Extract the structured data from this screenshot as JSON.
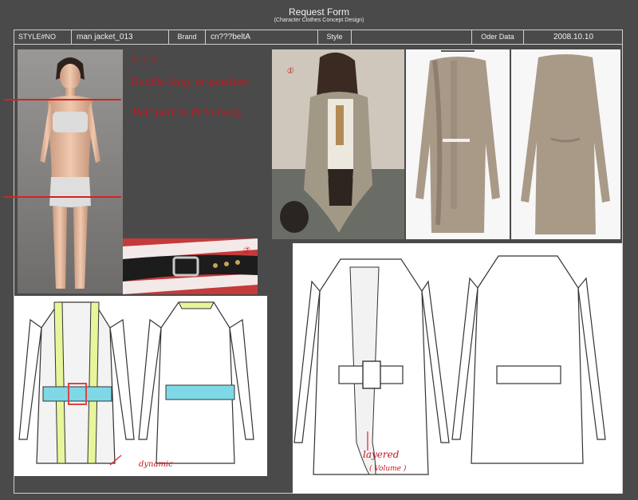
{
  "form": {
    "title": "Request Form",
    "subtitle": "(Character Clothes Concept Design)"
  },
  "header": {
    "style_no_label": "STYLE#NO",
    "style_no_value": "man jacket_013",
    "brand_label": "Brand",
    "brand_value": "cn???beltA",
    "style_label": "Style",
    "style_value": "",
    "order_date_label": "Oder Data",
    "order_date_value": "2008.10.10"
  },
  "annotations": {
    "marker_1": "① + ②",
    "note_line_1": "Double long, or position.",
    "note_line_2": "Belt part to fit to body.",
    "marker_belt": "②",
    "marker_photo": "①",
    "dynamic": "dynamic",
    "layered": "layered",
    "volume": "( Volume )"
  },
  "colors": {
    "background": "#4a4a4a",
    "accent_red": "#d32222",
    "trim_yellow": "#e8f59a",
    "belt_cyan": "#7fd8e6",
    "cardigan_taupe": "#a99a88"
  }
}
